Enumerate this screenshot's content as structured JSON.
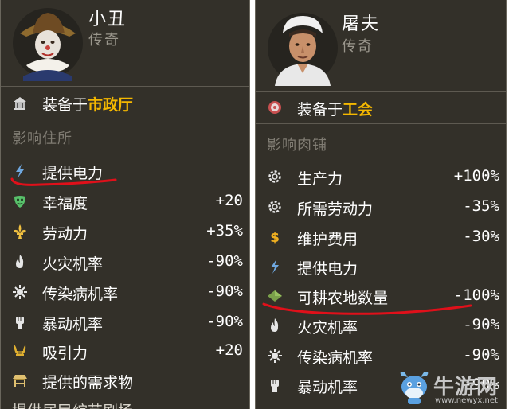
{
  "left_card": {
    "name": "小丑",
    "rarity": "传奇",
    "equip_prefix": "装备于",
    "equip_building": "市政厅",
    "section_title": "影响住所",
    "stats": [
      {
        "icon": "lightning-icon",
        "label": "提供电力",
        "value": ""
      },
      {
        "icon": "mask-icon",
        "label": "幸福度",
        "value": "+20"
      },
      {
        "icon": "fleur-de-lis-icon",
        "label": "劳动力",
        "value": "+35%"
      },
      {
        "icon": "fire-icon",
        "label": "火灾机率",
        "value": "-90%"
      },
      {
        "icon": "virus-icon",
        "label": "传染病机率",
        "value": "-90%"
      },
      {
        "icon": "fist-icon",
        "label": "暴动机率",
        "value": "-90%"
      },
      {
        "icon": "lyre-icon",
        "label": "吸引力",
        "value": "+20"
      },
      {
        "icon": "market-stall-icon",
        "label": "提供的需求物",
        "value": ""
      }
    ],
    "cut_label": "提供居民综艺剧场"
  },
  "right_card": {
    "name": "屠夫",
    "rarity": "传奇",
    "equip_prefix": "装备于",
    "equip_building": "工会",
    "section_title": "影响肉铺",
    "stats": [
      {
        "icon": "gear-icon",
        "label": "生产力",
        "value": "+100%"
      },
      {
        "icon": "gear-icon",
        "label": "所需劳动力",
        "value": "-35%"
      },
      {
        "icon": "dollar-coin-icon",
        "label": "维护费用",
        "value": "-30%"
      },
      {
        "icon": "lightning-icon",
        "label": "提供电力",
        "value": ""
      },
      {
        "icon": "farmland-icon",
        "label": "可耕农地数量",
        "value": "-100%"
      },
      {
        "icon": "fire-icon",
        "label": "火灾机率",
        "value": "-90%"
      },
      {
        "icon": "virus-icon",
        "label": "传染病机率",
        "value": "-90%"
      },
      {
        "icon": "fist-icon",
        "label": "暴动机率",
        "value": "-90%"
      }
    ]
  },
  "watermark": {
    "text": "牛游网",
    "url": "www.newyx.net"
  },
  "colors": {
    "panel_bg": "#333029",
    "accent_gold": "#f5b800",
    "muted_text": "#807c73",
    "annotation_red": "#e0101a"
  }
}
